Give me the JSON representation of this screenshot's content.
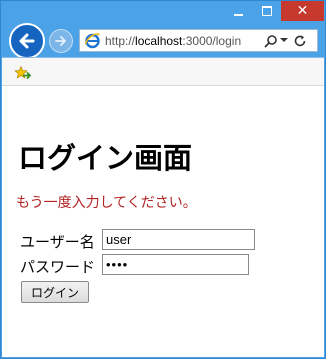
{
  "window": {
    "close_label": "✕"
  },
  "address_bar": {
    "url_scheme": "http://",
    "url_host": "localhost",
    "url_path": ":3000/login"
  },
  "page": {
    "title": "ログイン画面",
    "error_message": "もう一度入力してください。",
    "form": {
      "username_label": "ユーザー名",
      "username_value": "user",
      "password_label": "パスワード",
      "password_value": "pass",
      "submit_label": "ログイン"
    }
  },
  "colors": {
    "chrome_blue": "#4ba2e7",
    "close_red": "#c7382d",
    "error_red": "#b22222"
  }
}
